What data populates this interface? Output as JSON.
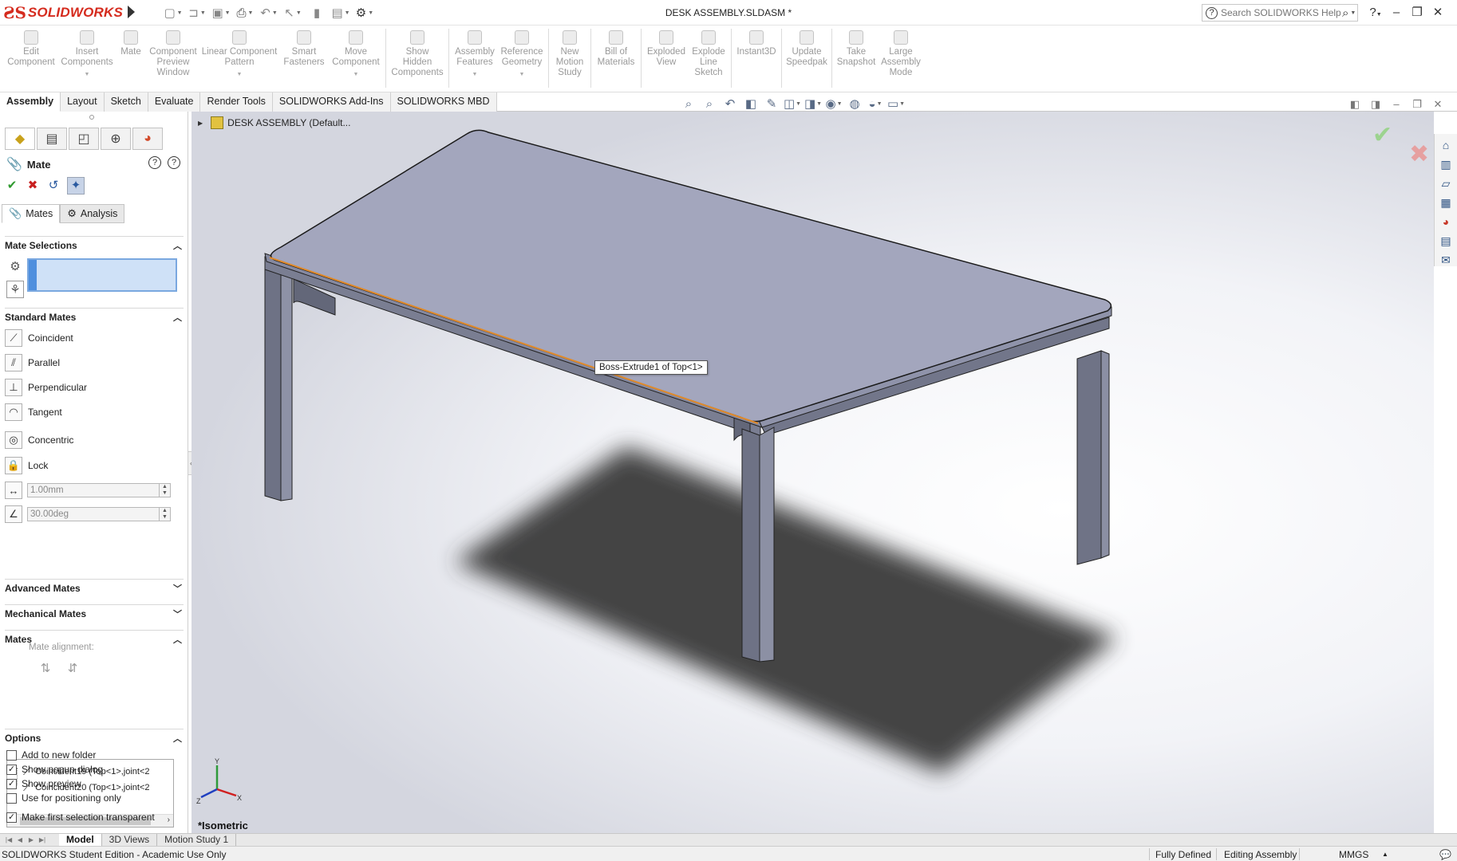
{
  "app": {
    "logo_ds": "ƧS",
    "logo_text": "SOLIDWORKS",
    "document_title": "DESK ASSEMBLY.SLDASM *",
    "help_search_placeholder": "Search SOLIDWORKS Help"
  },
  "quick_access": [
    "new-icon",
    "open-icon",
    "save-icon",
    "print-icon",
    "undo-icon",
    "select-icon",
    "rebuild-icon",
    "file-properties-icon",
    "options-icon"
  ],
  "ribbon": [
    {
      "id": "edit-component",
      "label": "Edit\nComponent",
      "arrow": false
    },
    {
      "id": "insert-components",
      "label": "Insert\nComponents",
      "arrow": true
    },
    {
      "id": "mate",
      "label": "Mate",
      "arrow": false
    },
    {
      "id": "component-preview-window",
      "label": "Component\nPreview\nWindow",
      "arrow": false
    },
    {
      "id": "linear-component-pattern",
      "label": "Linear Component\nPattern",
      "arrow": true
    },
    {
      "id": "smart-fasteners",
      "label": "Smart\nFasteners",
      "arrow": false
    },
    {
      "id": "move-component",
      "label": "Move\nComponent",
      "arrow": true
    },
    {
      "id": "show-hidden-components",
      "label": "Show\nHidden\nComponents",
      "arrow": false
    },
    {
      "id": "assembly-features",
      "label": "Assembly\nFeatures",
      "arrow": true
    },
    {
      "id": "reference-geometry",
      "label": "Reference\nGeometry",
      "arrow": true
    },
    {
      "id": "new-motion-study",
      "label": "New\nMotion\nStudy",
      "arrow": false
    },
    {
      "id": "bill-of-materials",
      "label": "Bill of\nMaterials",
      "arrow": false
    },
    {
      "id": "exploded-view",
      "label": "Exploded\nView",
      "arrow": false
    },
    {
      "id": "explode-line-sketch",
      "label": "Explode\nLine\nSketch",
      "arrow": false
    },
    {
      "id": "instant3d",
      "label": "Instant3D",
      "arrow": false
    },
    {
      "id": "update-speedpak",
      "label": "Update\nSpeedpak",
      "arrow": false
    },
    {
      "id": "take-snapshot",
      "label": "Take\nSnapshot",
      "arrow": false
    },
    {
      "id": "large-assembly-mode",
      "label": "Large\nAssembly\nMode",
      "arrow": false
    }
  ],
  "cm_tabs": [
    "Assembly",
    "Layout",
    "Sketch",
    "Evaluate",
    "Render Tools",
    "SOLIDWORKS Add-Ins",
    "SOLIDWORKS MBD"
  ],
  "property_manager": {
    "title": "Mate",
    "subtabs": [
      "Mates",
      "Analysis"
    ],
    "sections": {
      "mate_selections": "Mate Selections",
      "standard_mates": "Standard Mates",
      "advanced_mates": "Advanced Mates",
      "mechanical_mates": "Mechanical Mates",
      "mates": "Mates",
      "options": "Options"
    },
    "standard_mates": [
      "Coincident",
      "Parallel",
      "Perpendicular",
      "Tangent",
      "Concentric",
      "Lock"
    ],
    "distance_value": "1.00mm",
    "angle_value": "30.00deg",
    "mate_alignment_label": "Mate alignment:",
    "mates_list": [
      "Coincident19 (Top<1>,joint<2",
      "Coincident20 (Top<1>,joint<2"
    ],
    "options": [
      {
        "label": "Add to new folder",
        "checked": false
      },
      {
        "label": "Show popup dialog",
        "checked": true
      },
      {
        "label": "Show preview",
        "checked": true
      },
      {
        "label": "Use for positioning only",
        "checked": false
      },
      {
        "label": "Make first selection transparent",
        "checked": true
      }
    ]
  },
  "graphics": {
    "tree_root": "DESK ASSEMBLY  (Default...",
    "tooltip": "Boss-Extrude1 of Top<1>",
    "view_label": "*Isometric",
    "triad": {
      "x": "X",
      "y": "Y",
      "z": "Z"
    },
    "colors": {
      "part_face": "#a3a6bd",
      "part_side": "#737789",
      "edge_highlight": "#e08a2a",
      "shadow": "#3a3a3a"
    }
  },
  "bottom_tabs": [
    "Model",
    "3D Views",
    "Motion Study 1"
  ],
  "status": {
    "edition": "SOLIDWORKS Student Edition - Academic Use Only",
    "definition": "Fully Defined",
    "mode": "Editing Assembly",
    "units": "MMGS"
  }
}
